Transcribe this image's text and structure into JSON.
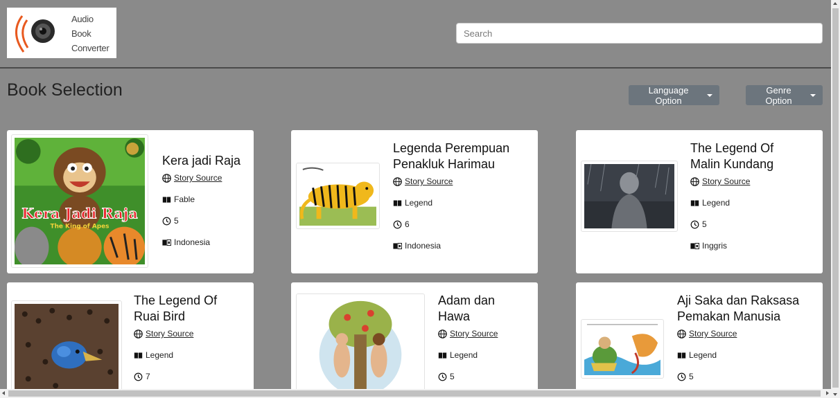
{
  "logo": {
    "line1": "Audio",
    "line2": "Book",
    "line3": "Converter"
  },
  "search": {
    "placeholder": "Search"
  },
  "page_title": "Book Selection",
  "filters": {
    "language": "Language Option",
    "genre": "Genre Option"
  },
  "books": [
    {
      "title_l1": "Kera jadi Raja",
      "title_l2": "",
      "source": "Story Source",
      "genre": "Fable",
      "duration": "5",
      "language": "Indonesia"
    },
    {
      "title_l1": "Legenda Perempuan",
      "title_l2": "Penakluk Harimau",
      "source": "Story Source",
      "genre": "Legend",
      "duration": "6",
      "language": "Indonesia"
    },
    {
      "title_l1": "The Legend Of",
      "title_l2": "Malin Kundang",
      "source": "Story Source",
      "genre": "Legend",
      "duration": "5",
      "language": "Inggris"
    },
    {
      "title_l1": "The Legend Of",
      "title_l2": "Ruai Bird",
      "source": "Story Source",
      "genre": "Legend",
      "duration": "7"
    },
    {
      "title_l1": "Adam dan",
      "title_l2": "Hawa",
      "source": "Story Source",
      "genre": "Legend",
      "duration": "5"
    },
    {
      "title_l1": "Aji Saka dan Raksasa",
      "title_l2": "Pemakan Manusia",
      "source": "Story Source",
      "genre": "Legend",
      "duration": "5"
    }
  ],
  "cover_text": {
    "kera_title": "Kera Jadi Raja",
    "kera_sub": "The King of Apes"
  },
  "colors": {
    "background": "#8a8a8a",
    "button": "#6c757d",
    "card": "#ffffff"
  }
}
